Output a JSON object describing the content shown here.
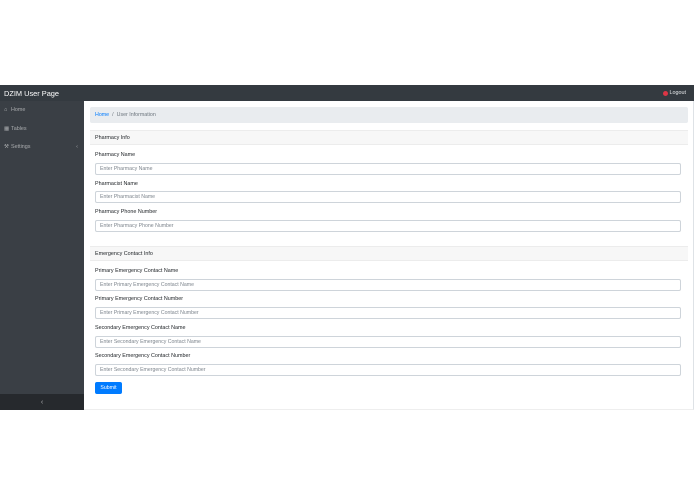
{
  "topbar": {
    "brand": "DZIM User Page",
    "logout_label": "Logout",
    "logout_icon": "power-icon"
  },
  "sidebar": {
    "items": [
      {
        "label": "Home",
        "icon": "home-icon"
      },
      {
        "label": "Tables",
        "icon": "table-icon"
      },
      {
        "label": "Settings",
        "icon": "wrench-icon"
      }
    ],
    "toggle_glyph": "‹"
  },
  "breadcrumb": {
    "home": "Home",
    "separator": "/",
    "current": "User Information"
  },
  "pharmacy": {
    "heading": "Pharmacy Info",
    "fields": [
      {
        "label": "Pharmacy Name",
        "placeholder": "Enter Pharmacy Name",
        "value": ""
      },
      {
        "label": "Pharmacist Name",
        "placeholder": "Enter Pharmacist Name",
        "value": ""
      },
      {
        "label": "Pharmacy Phone Number",
        "placeholder": "Enter Pharmacy Phone Number",
        "value": ""
      }
    ]
  },
  "emergency": {
    "heading": "Emergency Contact Info",
    "fields": [
      {
        "label": "Primary Emergency Contact Name",
        "placeholder": "Enter Primary Emergency Contact Name",
        "value": ""
      },
      {
        "label": "Primary Emergency Contact Number",
        "placeholder": "Enter Primary Emergency Contact Number",
        "value": ""
      },
      {
        "label": "Secondary Emergency Contact Name",
        "placeholder": "Enter Secondary Emergency Contact Name",
        "value": ""
      },
      {
        "label": "Secondary Emergency Contact Number",
        "placeholder": "Enter Secondary Emergency Contact Number",
        "value": ""
      }
    ]
  },
  "submit_label": "Submit",
  "colors": {
    "topbar": "#343a40",
    "sidebar": "#3a3f45",
    "primary": "#007bff",
    "logout_icon": "#dc3545"
  }
}
